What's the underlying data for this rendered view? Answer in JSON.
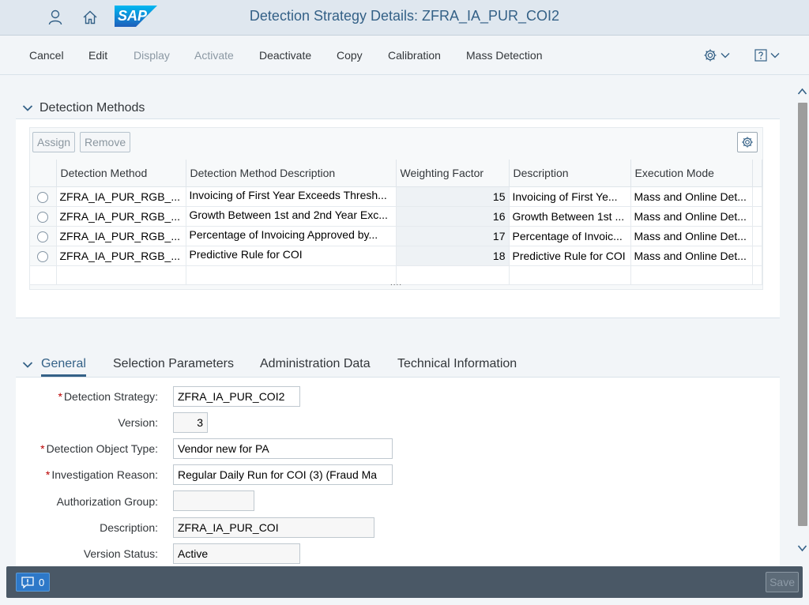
{
  "shell": {
    "title": "Detection Strategy Details: ZFRA_IA_PUR_COI2",
    "logo_text": "SAP"
  },
  "toolbar": {
    "cancel": "Cancel",
    "edit": "Edit",
    "display": "Display",
    "activate": "Activate",
    "deactivate": "Deactivate",
    "copy": "Copy",
    "calibration": "Calibration",
    "mass_detection": "Mass Detection"
  },
  "detection_methods": {
    "title": "Detection Methods",
    "assign": "Assign",
    "remove": "Remove",
    "columns": [
      "Detection Method",
      "Detection Method Description",
      "Weighting Factor",
      "Description",
      "Execution Mode"
    ],
    "rows": [
      {
        "method": "ZFRA_IA_PUR_RGB_...",
        "method_desc": "Invoicing of First Year Exceeds Thresh...",
        "weight": "15",
        "desc": "Invoicing of First Ye...",
        "mode": "Mass and Online Det..."
      },
      {
        "method": "ZFRA_IA_PUR_RGB_...",
        "method_desc": "Growth Between 1st and 2nd Year Exc...",
        "weight": "16",
        "desc": "Growth Between 1st ...",
        "mode": "Mass and Online Det..."
      },
      {
        "method": "ZFRA_IA_PUR_RGB_...",
        "method_desc": "Percentage of Invoicing Approved by...",
        "weight": "17",
        "desc": "Percentage of Invoic...",
        "mode": "Mass and Online Det..."
      },
      {
        "method": "ZFRA_IA_PUR_RGB_...",
        "method_desc": "Predictive Rule for COI",
        "weight": "18",
        "desc": "Predictive Rule for COI",
        "mode": "Mass and Online Det..."
      }
    ],
    "resize_handle": "...."
  },
  "tabs": {
    "general": "General",
    "selection": "Selection Parameters",
    "admin": "Administration Data",
    "technical": "Technical Information"
  },
  "form": {
    "detection_strategy": {
      "label": "Detection Strategy:",
      "value": "ZFRA_IA_PUR_COI2"
    },
    "version": {
      "label": "Version:",
      "value": "3"
    },
    "object_type": {
      "label": "Detection Object Type:",
      "value": "Vendor new for PA"
    },
    "investigation_reason": {
      "label": "Investigation Reason:",
      "value": "Regular Daily Run for COI (3) (Fraud Ma"
    },
    "authorization_group": {
      "label": "Authorization Group:",
      "value": ""
    },
    "description": {
      "label": "Description:",
      "value": "ZFRA_IA_PUR_COI"
    },
    "version_status": {
      "label": "Version Status:",
      "value": "Active"
    },
    "required_mark": "*"
  },
  "footer": {
    "message_count": "0",
    "save": "Save"
  },
  "colors": {
    "shell_bg": "#dfe7ef",
    "brand_blue": "#346187",
    "sap_logo": "#0a6ed1",
    "footer_bg": "#4a5866",
    "required": "#bb0000"
  }
}
